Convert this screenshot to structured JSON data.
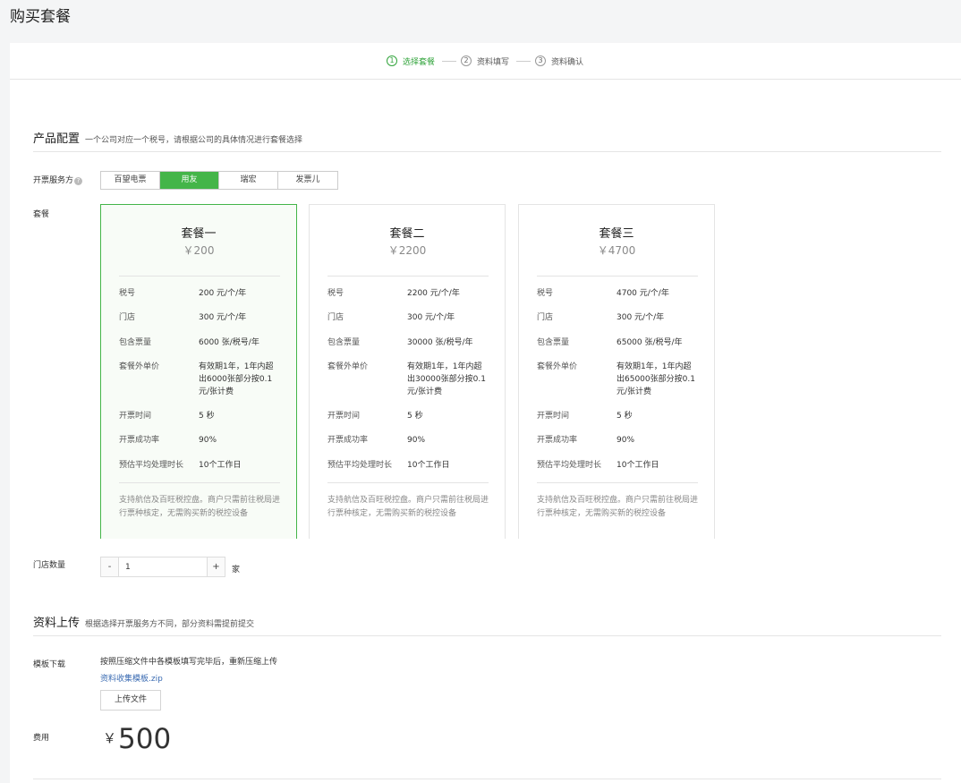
{
  "page": {
    "title": "购买套餐"
  },
  "steps": [
    {
      "num": "1",
      "label": "选择套餐"
    },
    {
      "num": "2",
      "label": "资料填写"
    },
    {
      "num": "3",
      "label": "资料确认"
    }
  ],
  "product_section": {
    "title": "产品配置",
    "subtitle": "一个公司对应一个税号，请根据公司的具体情况进行套餐选择"
  },
  "provider": {
    "label": "开票服务方",
    "help_icon": "?",
    "options": [
      "百望电票",
      "用友",
      "瑞宏",
      "发票儿"
    ],
    "selected": "用友"
  },
  "packages": {
    "label": "套餐",
    "selected": "套餐一",
    "items": [
      {
        "name": "套餐一",
        "price": "￥200",
        "rows": [
          {
            "k": "税号",
            "v": "200 元/个/年"
          },
          {
            "k": "门店",
            "v": "300 元/个/年"
          },
          {
            "k": "包含票量",
            "v": "6000 张/税号/年"
          },
          {
            "k": "套餐外单价",
            "v": "有效期1年，1年内超出6000张部分按0.1元/张计费"
          },
          {
            "k": "开票时间",
            "v": "5 秒"
          },
          {
            "k": "开票成功率",
            "v": "90%"
          },
          {
            "k": "预估平均处理时长",
            "v": "10个工作日"
          }
        ],
        "desc": "支持航信及百旺税控盘。商户只需前往税局进行票种核定，无需购买新的税控设备"
      },
      {
        "name": "套餐二",
        "price": "￥2200",
        "rows": [
          {
            "k": "税号",
            "v": "2200 元/个/年"
          },
          {
            "k": "门店",
            "v": "300 元/个/年"
          },
          {
            "k": "包含票量",
            "v": "30000 张/税号/年"
          },
          {
            "k": "套餐外单价",
            "v": "有效期1年，1年内超出30000张部分按0.1元/张计费"
          },
          {
            "k": "开票时间",
            "v": "5 秒"
          },
          {
            "k": "开票成功率",
            "v": "90%"
          },
          {
            "k": "预估平均处理时长",
            "v": "10个工作日"
          }
        ],
        "desc": "支持航信及百旺税控盘。商户只需前往税局进行票种核定，无需购买新的税控设备"
      },
      {
        "name": "套餐三",
        "price": "￥4700",
        "rows": [
          {
            "k": "税号",
            "v": "4700 元/个/年"
          },
          {
            "k": "门店",
            "v": "300 元/个/年"
          },
          {
            "k": "包含票量",
            "v": "65000 张/税号/年"
          },
          {
            "k": "套餐外单价",
            "v": "有效期1年，1年内超出65000张部分按0.1元/张计费"
          },
          {
            "k": "开票时间",
            "v": "5 秒"
          },
          {
            "k": "开票成功率",
            "v": "90%"
          },
          {
            "k": "预估平均处理时长",
            "v": "10个工作日"
          }
        ],
        "desc": "支持航信及百旺税控盘。商户只需前往税局进行票种核定，无需购买新的税控设备"
      }
    ]
  },
  "store_count": {
    "label": "门店数量",
    "minus": "-",
    "value": "1",
    "plus": "+",
    "unit": "家"
  },
  "upload_section": {
    "title": "资料上传",
    "subtitle": "根据选择开票服务方不同，部分资料需提前提交"
  },
  "template": {
    "label": "模板下载",
    "desc": "按照压缩文件中各模板填写完毕后，重新压缩上传",
    "link": "资料收集模板.zip",
    "upload_button": "上传文件"
  },
  "fee": {
    "label": "费用",
    "currency": "￥",
    "amount": "500"
  },
  "colors": {
    "accent": "#44b549",
    "link": "#3a6bb2"
  }
}
